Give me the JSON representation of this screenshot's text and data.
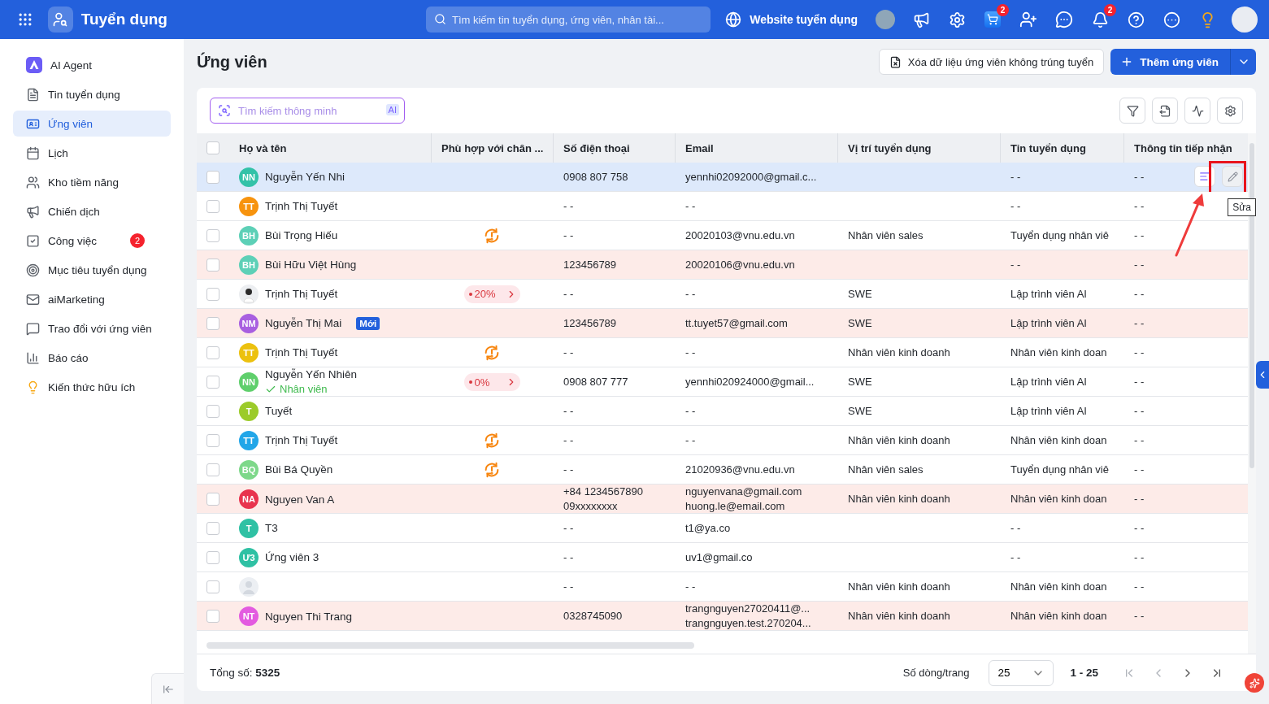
{
  "top_bar": {
    "app_title": "Tuyển dụng",
    "search_placeholder": "Tìm kiếm tin tuyển dụng, ứng viên, nhân tài...",
    "website_link": "Website tuyển dụng",
    "cart_badge": "2",
    "notification_badge": "2"
  },
  "sidebar": {
    "items": [
      {
        "label": "AI Agent",
        "selected": false
      },
      {
        "label": "Tin tuyển dụng",
        "selected": false
      },
      {
        "label": "Ứng viên",
        "selected": true
      },
      {
        "label": "Lịch",
        "selected": false
      },
      {
        "label": "Kho tiềm năng",
        "selected": false
      },
      {
        "label": "Chiến dịch",
        "selected": false
      },
      {
        "label": "Công việc",
        "selected": false,
        "badge": "2"
      },
      {
        "label": "Mục tiêu tuyển dụng",
        "selected": false
      },
      {
        "label": "aiMarketing",
        "selected": false
      },
      {
        "label": "Trao đổi với ứng viên",
        "selected": false
      },
      {
        "label": "Báo cáo",
        "selected": false
      },
      {
        "label": "Kiến thức hữu ích",
        "selected": false
      }
    ]
  },
  "page": {
    "title": "Ứng viên",
    "clear_button": "Xóa dữ liệu ứng viên không trúng tuyển",
    "add_button": "Thêm ứng viên"
  },
  "table": {
    "smart_search": {
      "placeholder": "Tìm kiếm thông minh",
      "ai_badge": "AI"
    },
    "all_checked": false,
    "columns": [
      "Họ và tên",
      "Phù hợp với chân ...",
      "Số điện thoại",
      "Email",
      "Vị trí tuyển dụng",
      "Tin tuyển dụng",
      "Thông tin tiếp nhận"
    ],
    "rows": [
      {
        "checked": false,
        "hovered": true,
        "flagged": false,
        "avatar": {
          "kind": "initials",
          "initials": "NN",
          "color": "#33c2a8"
        },
        "name": "Nguyễn Yến Nhi",
        "phone": [
          "0908 807 758"
        ],
        "email": [
          "yennhi02092000@gmail.c..."
        ],
        "job": "- -",
        "intake": "- -",
        "actions": {
          "tooltip": "Sửa",
          "highlighted": true
        }
      },
      {
        "checked": false,
        "hovered": false,
        "flagged": false,
        "avatar": {
          "kind": "initials",
          "initials": "TT",
          "color": "#f7930e"
        },
        "name": "Trịnh Thị Tuyết",
        "phone": [
          "- -"
        ],
        "email": [
          "- -"
        ],
        "job": "- -",
        "intake": "- -"
      },
      {
        "checked": false,
        "hovered": false,
        "flagged": false,
        "avatar": {
          "kind": "initials",
          "initials": "BH",
          "color": "#5dd0b7"
        },
        "name": "Bùi Trọng Hiếu",
        "match": {
          "kind": "warning"
        },
        "phone": [
          "- -"
        ],
        "email": [
          "20020103@vnu.edu.vn"
        ],
        "position": "Nhân viên sales",
        "job": "Tuyển dụng nhân viê",
        "intake": "- -"
      },
      {
        "checked": false,
        "hovered": false,
        "flagged": true,
        "avatar": {
          "kind": "initials",
          "initials": "BH",
          "color": "#5dd0b7"
        },
        "name": "Bùi Hữu Việt Hùng",
        "phone": [
          "123456789"
        ],
        "email": [
          "20020106@vnu.edu.vn"
        ],
        "job": "- -",
        "intake": "- -"
      },
      {
        "checked": false,
        "hovered": false,
        "flagged": false,
        "avatar": {
          "kind": "photo"
        },
        "name": "Trịnh Thị Tuyết",
        "match": {
          "kind": "percent",
          "text": "20%"
        },
        "phone": [
          "- -"
        ],
        "email": [
          "- -"
        ],
        "position": "SWE",
        "job": "Lập trình viên AI",
        "intake": "- -"
      },
      {
        "checked": false,
        "hovered": false,
        "flagged": true,
        "avatar": {
          "kind": "initials",
          "initials": "NM",
          "color": "#a85fe0"
        },
        "name": "Nguyễn Thị Mai",
        "tag": "Mới",
        "phone": [
          "123456789"
        ],
        "email": [
          "tt.tuyet57@gmail.com"
        ],
        "position": "SWE",
        "job": "Lập trình viên AI",
        "intake": "- -"
      },
      {
        "checked": false,
        "hovered": false,
        "flagged": false,
        "avatar": {
          "kind": "initials",
          "initials": "TT",
          "color": "#ecc10f"
        },
        "name": "Trịnh Thị Tuyết",
        "match": {
          "kind": "warning"
        },
        "phone": [
          "- -"
        ],
        "email": [
          "- -"
        ],
        "position": "Nhân viên kinh doanh",
        "job": "Nhân viên kinh doan",
        "intake": "- -"
      },
      {
        "checked": false,
        "hovered": false,
        "flagged": false,
        "avatar": {
          "kind": "initials",
          "initials": "NN",
          "color": "#5fcf6c"
        },
        "name": "Nguyễn Yến Nhiên",
        "status": "Nhân viên",
        "match": {
          "kind": "percent",
          "text": "0%"
        },
        "phone": [
          "0908 807 777"
        ],
        "email": [
          "yennhi020924000@gmail..."
        ],
        "position": "SWE",
        "job": "Lập trình viên AI",
        "intake": "- -"
      },
      {
        "checked": false,
        "hovered": false,
        "flagged": false,
        "avatar": {
          "kind": "initials",
          "initials": "T",
          "color": "#9ccb2a"
        },
        "name": "Tuyết",
        "phone": [
          "- -"
        ],
        "email": [
          "- -"
        ],
        "position": "SWE",
        "job": "Lập trình viên AI",
        "intake": "- -"
      },
      {
        "checked": false,
        "hovered": false,
        "flagged": false,
        "avatar": {
          "kind": "initials",
          "initials": "TT",
          "color": "#22a6e8"
        },
        "name": "Trịnh Thị Tuyết",
        "match": {
          "kind": "warning"
        },
        "phone": [
          "- -"
        ],
        "email": [
          "- -"
        ],
        "position": "Nhân viên kinh doanh",
        "job": "Nhân viên kinh doan",
        "intake": "- -"
      },
      {
        "checked": false,
        "hovered": false,
        "flagged": false,
        "avatar": {
          "kind": "initials",
          "initials": "BQ",
          "color": "#7ed88a"
        },
        "name": "Bùi Bá Quyền",
        "match": {
          "kind": "warning"
        },
        "phone": [
          "- -"
        ],
        "email": [
          "21020936@vnu.edu.vn"
        ],
        "position": "Nhân viên sales",
        "job": "Tuyển dụng nhân viê",
        "intake": "- -"
      },
      {
        "checked": false,
        "hovered": false,
        "flagged": true,
        "avatar": {
          "kind": "initials",
          "initials": "NA",
          "color": "#e8344e"
        },
        "name": "Nguyen Van A",
        "phone": [
          "+84 1234567890",
          "09xxxxxxxx"
        ],
        "email": [
          "nguyenvana@gmail.com",
          "huong.le@email.com"
        ],
        "position": "Nhân viên kinh doanh",
        "job": "Nhân viên kinh doan",
        "intake": "- -"
      },
      {
        "checked": false,
        "hovered": false,
        "flagged": false,
        "avatar": {
          "kind": "initials",
          "initials": "T",
          "color": "#2fc1a4"
        },
        "name": "T3",
        "phone": [
          "- -"
        ],
        "email": [
          "t1@ya.co"
        ],
        "job": "- -",
        "intake": "- -"
      },
      {
        "checked": false,
        "hovered": false,
        "flagged": false,
        "avatar": {
          "kind": "initials",
          "initials": "Ư3",
          "color": "#2fc1a4"
        },
        "name": "Ứng viên 3",
        "phone": [
          "- -"
        ],
        "email": [
          "uv1@gmail.co"
        ],
        "job": "- -",
        "intake": "- -"
      },
      {
        "checked": false,
        "hovered": false,
        "flagged": false,
        "avatar": {
          "kind": "placeholder"
        },
        "phone": [
          "- -"
        ],
        "email": [
          "- -"
        ],
        "position": "Nhân viên kinh doanh",
        "job": "Nhân viên kinh doan",
        "intake": "- -"
      },
      {
        "checked": false,
        "hovered": false,
        "flagged": true,
        "avatar": {
          "kind": "initials",
          "initials": "NT",
          "color": "#e35be0"
        },
        "name": "Nguyen Thi Trang",
        "phone": [
          "0328745090"
        ],
        "email": [
          "trangnguyen27020411@...",
          "trangnguyen.test.270204..."
        ],
        "position": "Nhân viên kinh doanh",
        "job": "Nhân viên kinh doan",
        "intake": "- -"
      }
    ]
  },
  "footer": {
    "total": "Tổng số: **5325**",
    "rows_per_page_label": "Số dòng/trang",
    "rows_per_page": "25",
    "range": "1 - 25"
  }
}
